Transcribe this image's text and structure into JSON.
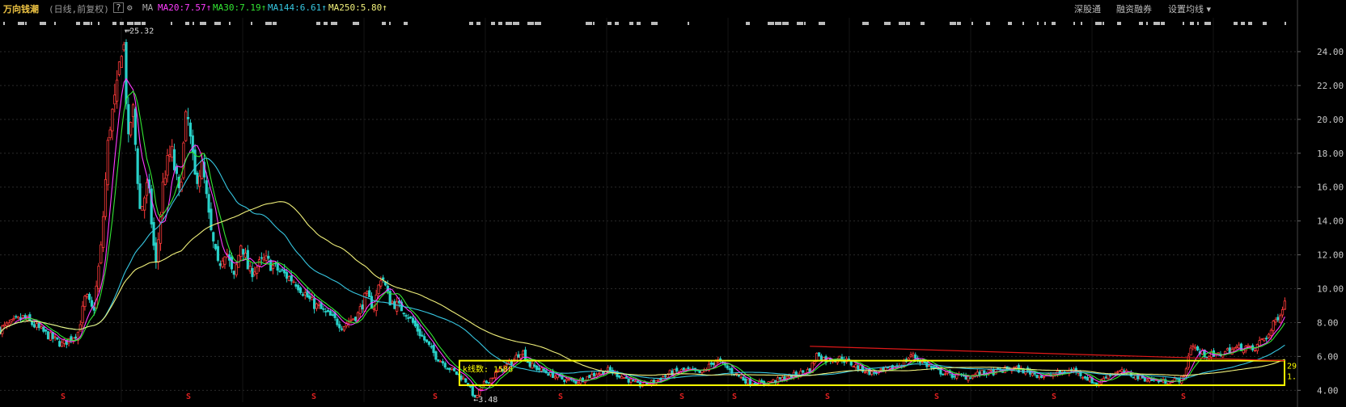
{
  "header": {
    "stock_name": "万向钱潮",
    "period": "(日线,前复权)",
    "help_label": "?",
    "indicator": "MA",
    "ma": [
      {
        "label": "MA20:7.57",
        "arrow": "↑",
        "color": "#ff3cff"
      },
      {
        "label": "MA30:7.19",
        "arrow": "↑",
        "color": "#33e633"
      },
      {
        "label": "MA144:6.61",
        "arrow": "↑",
        "color": "#36c6e0"
      },
      {
        "label": "MA250:5.80",
        "arrow": "↑",
        "color": "#f0f07a"
      }
    ],
    "menu": [
      "深股通",
      "融资融券",
      "设置均线 ▾"
    ]
  },
  "colors": {
    "up": "#ff3a3a",
    "down": "#28d0c8",
    "box": "#ffff00",
    "trend": "#e01818",
    "grid": "#2a2a2a"
  },
  "icons": {
    "settings": "gear-icon"
  },
  "annotations": {
    "high_label": "25.32",
    "low_label": "3.48",
    "box_label": "k线数: 1588",
    "box_right_top": "29",
    "box_right_bottom": "1."
  },
  "chart_data": {
    "type": "candlestick",
    "ylim": [
      3.3,
      26.0
    ],
    "y_ticks": [
      "24.00",
      "22.00",
      "20.00",
      "18.00",
      "16.00",
      "14.00",
      "12.00",
      "10.00",
      "8.00",
      "6.00",
      "4.00"
    ],
    "grid": true,
    "price_series": [
      [
        0,
        7.6
      ],
      [
        3,
        8.3
      ],
      [
        6,
        7.3
      ],
      [
        8,
        6.7
      ],
      [
        10,
        7.4
      ],
      [
        11,
        9.6
      ],
      [
        12,
        8.6
      ],
      [
        13,
        12.5
      ],
      [
        14,
        19.5
      ],
      [
        15,
        21.5
      ],
      [
        15.8,
        25.32
      ],
      [
        16.5,
        18.5
      ],
      [
        17,
        21
      ],
      [
        18,
        14.5
      ],
      [
        19,
        16.2
      ],
      [
        20,
        11.2
      ],
      [
        21,
        16.5
      ],
      [
        22,
        18.2
      ],
      [
        23,
        15.5
      ],
      [
        24,
        20.5
      ],
      [
        25,
        16.5
      ],
      [
        26,
        17.2
      ],
      [
        27,
        13.5
      ],
      [
        28,
        11.3
      ],
      [
        29,
        12.4
      ],
      [
        30,
        10.5
      ],
      [
        31,
        12.8
      ],
      [
        32,
        10.9
      ],
      [
        34,
        11.7
      ],
      [
        36,
        11.0
      ],
      [
        38,
        10.4
      ],
      [
        40,
        9.2
      ],
      [
        42,
        8.5
      ],
      [
        44,
        7.8
      ],
      [
        46,
        8.5
      ],
      [
        47,
        9.6
      ],
      [
        48,
        8.9
      ],
      [
        49,
        10.9
      ],
      [
        50,
        9.3
      ],
      [
        52,
        8.7
      ],
      [
        54,
        7.3
      ],
      [
        56,
        6.0
      ],
      [
        58,
        5.2
      ],
      [
        60,
        4.5
      ],
      [
        61,
        3.48
      ],
      [
        62,
        4.3
      ],
      [
        64,
        5.1
      ],
      [
        66,
        5.8
      ],
      [
        67,
        6.4
      ],
      [
        68,
        5.5
      ],
      [
        70,
        5.1
      ],
      [
        72,
        4.7
      ],
      [
        74,
        4.5
      ],
      [
        76,
        4.9
      ],
      [
        78,
        5.2
      ],
      [
        80,
        4.8
      ],
      [
        82,
        4.3
      ],
      [
        84,
        4.5
      ],
      [
        86,
        5.0
      ],
      [
        88,
        5.2
      ],
      [
        90,
        5.0
      ],
      [
        92,
        5.8
      ],
      [
        94,
        5.1
      ],
      [
        96,
        4.5
      ],
      [
        98,
        4.4
      ],
      [
        100,
        4.6
      ],
      [
        102,
        4.9
      ],
      [
        104,
        5.2
      ],
      [
        105,
        6.2
      ],
      [
        106,
        5.8
      ],
      [
        108,
        5.9
      ],
      [
        110,
        5.4
      ],
      [
        112,
        5.0
      ],
      [
        114,
        5.2
      ],
      [
        116,
        5.6
      ],
      [
        117,
        6.1
      ],
      [
        118,
        5.8
      ],
      [
        120,
        5.2
      ],
      [
        122,
        4.9
      ],
      [
        124,
        4.8
      ],
      [
        126,
        5.0
      ],
      [
        128,
        5.1
      ],
      [
        130,
        5.3
      ],
      [
        132,
        5.1
      ],
      [
        134,
        4.8
      ],
      [
        136,
        5.0
      ],
      [
        138,
        5.2
      ],
      [
        140,
        4.6
      ],
      [
        141,
        4.3
      ],
      [
        142,
        4.9
      ],
      [
        144,
        5.1
      ],
      [
        146,
        4.8
      ],
      [
        148,
        4.6
      ],
      [
        150,
        4.5
      ],
      [
        152,
        4.7
      ],
      [
        153,
        6.8
      ],
      [
        154,
        6.2
      ],
      [
        156,
        6.0
      ],
      [
        158,
        6.4
      ],
      [
        160,
        6.6
      ],
      [
        161,
        6.3
      ],
      [
        162,
        7.0
      ],
      [
        163,
        7.3
      ],
      [
        164,
        8.3
      ],
      [
        165,
        9.2
      ]
    ],
    "moving_averages": [
      {
        "name": "MA20",
        "color": "#ff3cff",
        "value": 7.57
      },
      {
        "name": "MA30",
        "color": "#33e633",
        "value": 7.19
      },
      {
        "name": "MA144",
        "color": "#36c6e0",
        "value": 6.61
      },
      {
        "name": "MA250",
        "color": "#f0f07a",
        "value": 5.8
      }
    ],
    "consolidation_box": {
      "from_index": 59,
      "to_index": 166,
      "low": 4.3,
      "high": 5.75
    },
    "trend_line": {
      "from_index": 104,
      "from": 6.6,
      "to_index": 166,
      "to": 5.75
    },
    "high": 25.32,
    "low": 3.48
  }
}
